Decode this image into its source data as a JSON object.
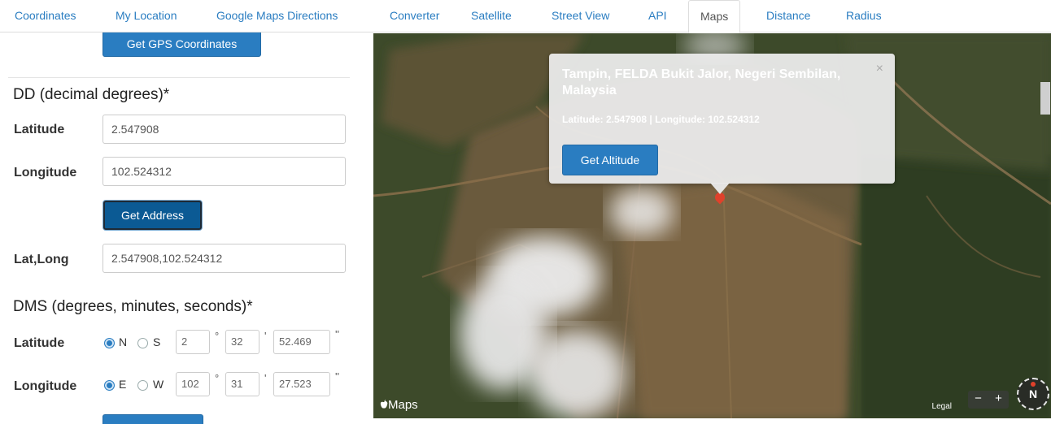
{
  "nav": {
    "tabs": [
      {
        "label": "Coordinates"
      },
      {
        "label": "My Location"
      },
      {
        "label": "Google Maps Directions"
      },
      {
        "label": "Converter"
      },
      {
        "label": "Satellite"
      },
      {
        "label": "Street View"
      },
      {
        "label": "API"
      },
      {
        "label": "Maps",
        "active": true
      },
      {
        "label": "Distance"
      },
      {
        "label": "Radius"
      }
    ]
  },
  "panel": {
    "gps_button": "Get GPS Coordinates",
    "dd": {
      "title": "DD (decimal degrees)*",
      "latitude_label": "Latitude",
      "latitude_value": "2.547908",
      "longitude_label": "Longitude",
      "longitude_value": "102.524312",
      "get_address_button": "Get Address",
      "latlong_label": "Lat,Long",
      "latlong_value": "2.547908,102.524312"
    },
    "dms": {
      "title": "DMS (degrees, minutes, seconds)*",
      "latitude_label": "Latitude",
      "lat_option_1": "N",
      "lat_option_2": "S",
      "lat_selected": "N",
      "lat_degrees": "2",
      "lat_minutes": "32",
      "lat_seconds": "52.469",
      "longitude_label": "Longitude",
      "lon_option_1": "E",
      "lon_option_2": "W",
      "lon_selected": "E",
      "lon_degrees": "102",
      "lon_minutes": "31",
      "lon_seconds": "27.523",
      "degree_symbol": "°",
      "minute_symbol": "'",
      "second_symbol": "''"
    }
  },
  "map": {
    "popup": {
      "title": "Tampin, FELDA Bukit Jalor, Negeri Sembilan, Malaysia",
      "coords": "Latitude: 2.547908 | Longitude: 102.524312",
      "close": "×",
      "altitude_button": "Get Altitude"
    },
    "brand": "Maps",
    "brand_logo": "apple-logo-icon",
    "legal": "Legal",
    "zoom_out": "−",
    "zoom_in": "+",
    "compass_label": "N",
    "colors": {
      "accent": "#2a7dc1",
      "marker": "#e0412b"
    }
  }
}
